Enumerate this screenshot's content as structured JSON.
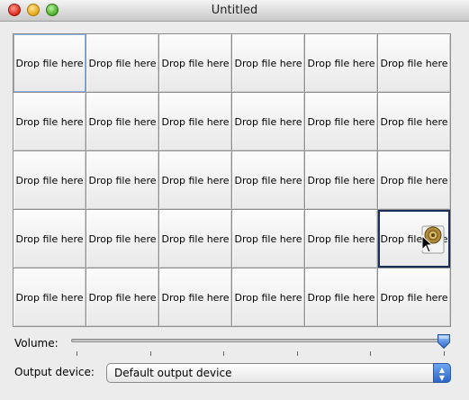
{
  "window": {
    "title": "Untitled"
  },
  "grid": {
    "rows": [
      [
        "Drop file here",
        "Drop file here",
        "Drop file here",
        "Drop file here",
        "Drop file here",
        "Drop file here"
      ],
      [
        "Drop file here",
        "Drop file here",
        "Drop file here",
        "Drop file here",
        "Drop file here",
        "Drop file here"
      ],
      [
        "Drop file here",
        "Drop file here",
        "Drop file here",
        "Drop file here",
        "Drop file here",
        "Drop file here"
      ],
      [
        "Drop file here",
        "Drop file here",
        "Drop file here",
        "Drop file here",
        "Drop file here",
        "Drop file here"
      ],
      [
        "Drop file here",
        "Drop file here",
        "Drop file here",
        "Drop file here",
        "Drop file here",
        "Drop file here"
      ]
    ],
    "focused_cell": [
      0,
      0
    ],
    "selected_cell": [
      3,
      5
    ],
    "drag_icon": "audio-file-icon",
    "cursor_icon": "arrow-cursor-icon"
  },
  "volume": {
    "label": "Volume:",
    "value_fraction": 1.0,
    "tick_count": 6
  },
  "output": {
    "label": "Output device:",
    "selected": "Default output device"
  },
  "colors": {
    "selection_border": "#1a2f5a",
    "focus_ring": "#8cb1df",
    "popup_accent": "#2b66c9"
  }
}
